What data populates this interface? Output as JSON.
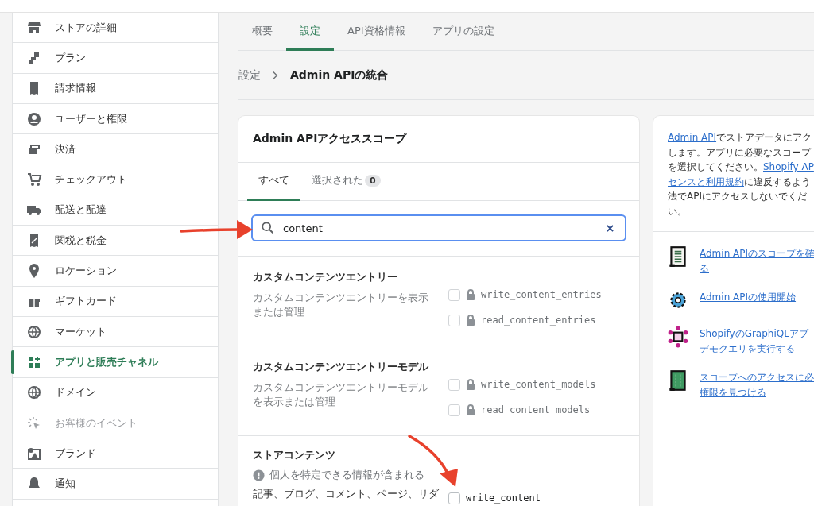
{
  "sidebar": {
    "items": [
      {
        "label": "ストアの詳細",
        "selected": false,
        "disabled": false
      },
      {
        "label": "プラン",
        "selected": false,
        "disabled": false
      },
      {
        "label": "請求情報",
        "selected": false,
        "disabled": false
      },
      {
        "label": "ユーザーと権限",
        "selected": false,
        "disabled": false
      },
      {
        "label": "決済",
        "selected": false,
        "disabled": false
      },
      {
        "label": "チェックアウト",
        "selected": false,
        "disabled": false
      },
      {
        "label": "配送と配達",
        "selected": false,
        "disabled": false
      },
      {
        "label": "関税と税金",
        "selected": false,
        "disabled": false
      },
      {
        "label": "ロケーション",
        "selected": false,
        "disabled": false
      },
      {
        "label": "ギフトカード",
        "selected": false,
        "disabled": false
      },
      {
        "label": "マーケット",
        "selected": false,
        "disabled": false
      },
      {
        "label": "アプリと販売チャネル",
        "selected": true,
        "disabled": false
      },
      {
        "label": "ドメイン",
        "selected": false,
        "disabled": false
      },
      {
        "label": "お客様のイベント",
        "selected": false,
        "disabled": true
      },
      {
        "label": "ブランド",
        "selected": false,
        "disabled": false
      },
      {
        "label": "通知",
        "selected": false,
        "disabled": false
      }
    ]
  },
  "tabs": [
    {
      "label": "概要",
      "selected": false
    },
    {
      "label": "設定",
      "selected": true
    },
    {
      "label": "API資格情報",
      "selected": false
    },
    {
      "label": "アプリの設定",
      "selected": false
    }
  ],
  "breadcrumb": {
    "parent": "設定",
    "current": "Admin APIの統合"
  },
  "scopes_card": {
    "title": "Admin APIアクセススコープ",
    "tabs": [
      {
        "label": "すべて",
        "selected": true
      },
      {
        "label": "選択された",
        "count": "0",
        "selected": false
      }
    ],
    "search": {
      "value": "content"
    },
    "sections": [
      {
        "title": "カスタムコンテンツエントリー",
        "description": "カスタムコンテンツエントリーを表示または管理",
        "scopes": [
          {
            "name": "write_content_entries",
            "checked": false,
            "locked": true
          },
          {
            "name": "read_content_entries",
            "checked": false,
            "locked": true
          }
        ]
      },
      {
        "title": "カスタムコンテンツエントリーモデル",
        "description": "カスタムコンテンツエントリーモデルを表示または管理",
        "scopes": [
          {
            "name": "write_content_models",
            "checked": false,
            "locked": true
          },
          {
            "name": "read_content_models",
            "checked": false,
            "locked": true
          }
        ]
      },
      {
        "title": "ストアコンテンツ",
        "warning": "個人を特定できる情報が含まれる",
        "description": "記事、ブログ、コメント、ページ、リダ",
        "scopes": [
          {
            "name": "write_content",
            "checked": false,
            "locked": false
          }
        ]
      }
    ]
  },
  "info_card": {
    "lines": [
      [
        {
          "text": "Admin API",
          "link": true
        },
        {
          "text": "でストアデータにアク",
          "link": false
        }
      ],
      [
        {
          "text": "します。アプリに必要なスコープ",
          "link": false
        }
      ],
      [
        {
          "text": "を選択してください。",
          "link": false
        },
        {
          "text": "Shopify AP",
          "link": true
        }
      ],
      [
        {
          "text": "センスと利用規約",
          "link": true
        },
        {
          "text": "に違反するよう",
          "link": false
        }
      ],
      [
        {
          "text": "法でAPIにアクセスしないでくだ",
          "link": false
        }
      ],
      [
        {
          "text": "い。",
          "link": false
        }
      ]
    ],
    "links": [
      {
        "lines": [
          "Admin APIのスコープを確",
          "る"
        ]
      },
      {
        "lines": [
          "Admin APIの使用開始"
        ]
      },
      {
        "lines": [
          "ShopifyのGraphiQLアプ",
          "デモクエリを実行する"
        ]
      },
      {
        "lines": [
          "スコープへのアクセスに必",
          "権限を見つける"
        ]
      }
    ]
  }
}
